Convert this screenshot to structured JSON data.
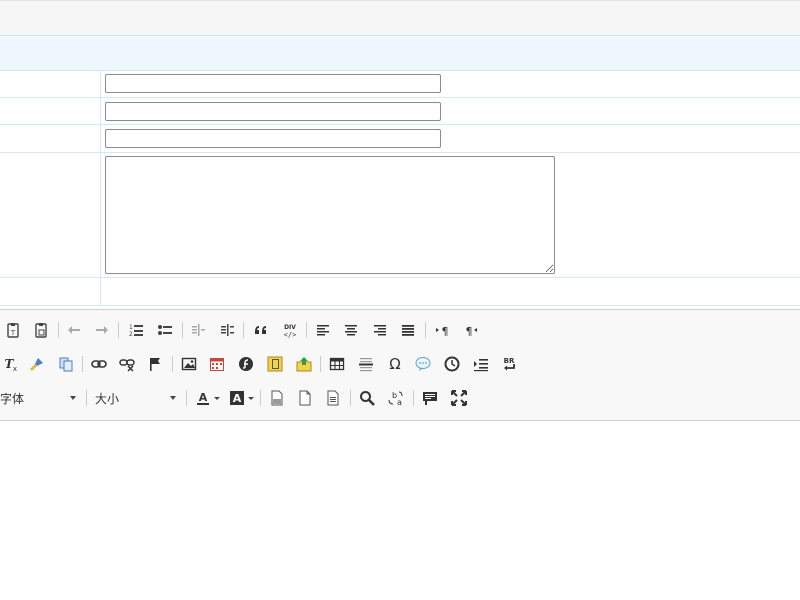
{
  "form": {
    "fields": [
      {
        "value": "",
        "placeholder": ""
      },
      {
        "value": "",
        "placeholder": ""
      },
      {
        "value": "",
        "placeholder": ""
      }
    ],
    "textarea": {
      "value": ""
    }
  },
  "editor": {
    "font_label": "字体",
    "size_label": "大小",
    "toolbar_row1": [
      "paste-text-icon",
      "paste-word-icon",
      "undo-icon",
      "redo-icon",
      "numbered-list-icon",
      "bulleted-list-icon",
      "outdent-icon",
      "indent-icon",
      "blockquote-icon",
      "create-div-icon",
      "align-left-icon",
      "align-center-icon",
      "align-right-icon",
      "justify-icon",
      "ltr-icon",
      "rtl-icon"
    ],
    "toolbar_row2": [
      "remove-format-icon",
      "copy-format-icon",
      "templates-icon",
      "link-icon",
      "unlink-icon",
      "anchor-icon",
      "image-icon",
      "insert-date-icon",
      "flash-icon",
      "insert-file-icon",
      "upload-icon",
      "table-icon",
      "horizontal-rule-icon",
      "special-char-icon",
      "smiley-icon",
      "clock-icon",
      "insert-code-icon",
      "line-break-icon"
    ],
    "toolbar_row3": [
      "text-color-icon",
      "background-color-icon",
      "preview-icon",
      "new-page-icon",
      "document-icon",
      "find-icon",
      "replace-icon",
      "show-blocks-icon",
      "maximize-icon"
    ],
    "special_char_glyph": "Ω",
    "br_glyph": "BR"
  },
  "colors": {
    "header_bg": "#eef7fe",
    "row_border": "#d4e9f6",
    "toolbar_bg": "#f8f8f8"
  }
}
